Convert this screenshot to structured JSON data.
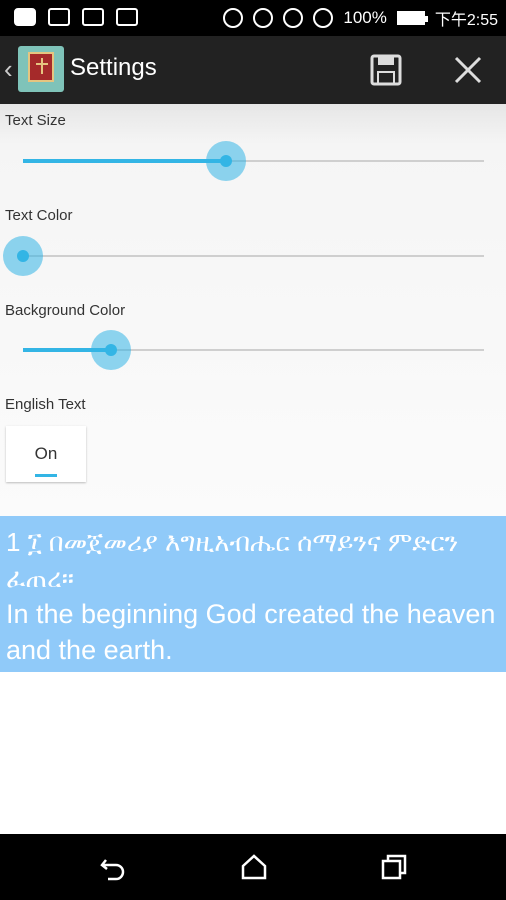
{
  "status_bar": {
    "battery": "100%",
    "time": "下午2:55"
  },
  "action_bar": {
    "title": "Settings",
    "icons": [
      "back-chevron-icon",
      "app-bible-icon",
      "save-icon",
      "close-icon"
    ]
  },
  "settings": {
    "text_size": {
      "label": "Text Size",
      "value": 0.44
    },
    "text_color": {
      "label": "Text Color",
      "value": 0.0
    },
    "background_color": {
      "label": "Background Color",
      "value": 0.19
    },
    "english_text": {
      "label": "English Text",
      "state": "On"
    }
  },
  "preview": {
    "verse_number": "1",
    "amharic": "፲ በመጀመሪያ እግዚአብሔር ሰማይንና ምድርን ፈጠረ።",
    "english": "In the beginning God created the heaven and the earth."
  },
  "colors": {
    "accent": "#33b5e5",
    "preview_bg": "#90caf9",
    "action_bar": "#222222"
  },
  "nav_bar": {
    "icons": [
      "back-icon",
      "home-icon",
      "recents-icon"
    ]
  }
}
